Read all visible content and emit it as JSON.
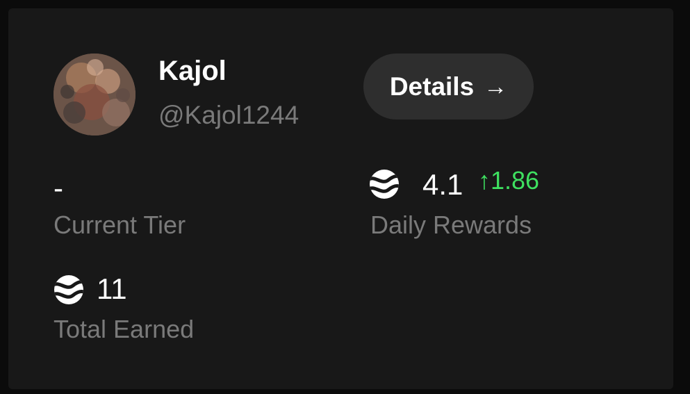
{
  "profile": {
    "name": "Kajol",
    "handle": "@Kajol1244"
  },
  "details_button": {
    "label": "Details",
    "arrow": "→"
  },
  "stats": {
    "current_tier": {
      "value": "-",
      "label": "Current Tier"
    },
    "daily_rewards": {
      "value": "4.1",
      "change": "↑1.86",
      "label": "Daily Rewards",
      "token_icon": "token-coin-icon"
    },
    "total_earned": {
      "value": "11",
      "label": "Total Earned",
      "token_icon": "token-coin-icon"
    }
  },
  "colors": {
    "background": "#0b0b0b",
    "card": "#181818",
    "button": "#2e2e2e",
    "text_primary": "#ffffff",
    "text_secondary": "#7a7a7a",
    "positive": "#3ee060"
  }
}
